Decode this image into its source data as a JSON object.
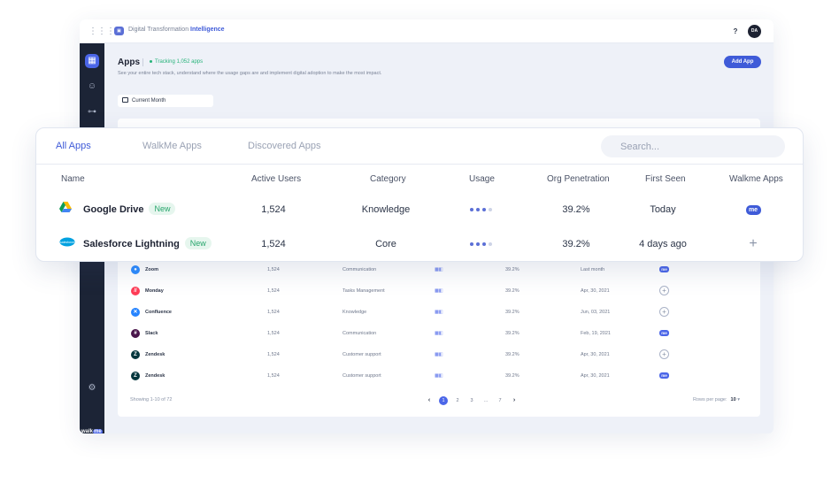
{
  "topbar": {
    "brand_prefix": "Digital Transformation",
    "brand_suffix": "Intelligence",
    "help": "?",
    "avatar_initials": "DA"
  },
  "header": {
    "title": "Apps",
    "tracking": "Tracking 1,052 apps",
    "subtitle": "See your entire tech stack, understand where the usage gaps are and implement digital adoption to make the most impact.",
    "add_app_label": "Add App"
  },
  "filter": {
    "date_range": "Current Month"
  },
  "sidebar": {
    "brand": "walk",
    "brand_badge": "me"
  },
  "colors": {
    "accent": "#3f5bd8",
    "sidebar": "#1c2436",
    "new_badge": "#27a56c"
  },
  "overlay": {
    "tabs": [
      {
        "label": "All Apps",
        "active": true
      },
      {
        "label": "WalkMe Apps",
        "active": false
      },
      {
        "label": "Discovered Apps",
        "active": false
      }
    ],
    "search_placeholder": "Search...",
    "columns": {
      "name": "Name",
      "active_users": "Active Users",
      "category": "Category",
      "usage": "Usage",
      "org_penetration": "Org Penetration",
      "first_seen": "First Seen",
      "walkme_apps": "Walkme Apps"
    },
    "rows": [
      {
        "name": "Google Drive",
        "badge": "New",
        "active_users": "1,524",
        "category": "Knowledge",
        "usage_level": 3,
        "org_penetration": "39.2%",
        "first_seen": "Today",
        "walkme": "me",
        "icon": "google-drive-icon"
      },
      {
        "name": "Salesforce Lightning",
        "badge": "New",
        "active_users": "1,524",
        "category": "Core",
        "usage_level": 3,
        "org_penetration": "39.2%",
        "first_seen": "4 days ago",
        "walkme": "+",
        "icon": "salesforce-icon"
      }
    ]
  },
  "table": {
    "rows": [
      {
        "name": "Zoom",
        "active_users": "1,524",
        "category": "Communication",
        "org_penetration": "39.2%",
        "first_seen": "Last month",
        "walkme": "me",
        "icon_color": "#2d8cff",
        "icon_char": "●"
      },
      {
        "name": "Monday",
        "active_users": "1,524",
        "category": "Tasks Management",
        "org_penetration": "39.2%",
        "first_seen": "Apr, 30, 2021",
        "walkme": "+",
        "icon_color": "#ff3d57",
        "icon_char": "//"
      },
      {
        "name": "Confluence",
        "active_users": "1,524",
        "category": "Knowledge",
        "org_penetration": "39.2%",
        "first_seen": "Jun, 03, 2021",
        "walkme": "+",
        "icon_color": "#2684ff",
        "icon_char": "✕"
      },
      {
        "name": "Slack",
        "active_users": "1,524",
        "category": "Communication",
        "org_penetration": "39.2%",
        "first_seen": "Feb, 19, 2021",
        "walkme": "me",
        "icon_color": "#4a154b",
        "icon_char": "#"
      },
      {
        "name": "Zendesk",
        "active_users": "1,524",
        "category": "Customer support",
        "org_penetration": "39.2%",
        "first_seen": "Apr, 30, 2021",
        "walkme": "+",
        "icon_color": "#03363d",
        "icon_char": "Z"
      },
      {
        "name": "Zendesk",
        "active_users": "1,524",
        "category": "Customer support",
        "org_penetration": "39.2%",
        "first_seen": "Apr, 30, 2021",
        "walkme": "me",
        "icon_color": "#03363d",
        "icon_char": "Z"
      }
    ],
    "footer": {
      "showing": "Showing 1-10 of 72",
      "pages": [
        "1",
        "2",
        "3",
        "...",
        "7"
      ],
      "active_page": "1",
      "rows_per_page_label": "Rows per page:",
      "rows_per_page_value": "10"
    }
  }
}
